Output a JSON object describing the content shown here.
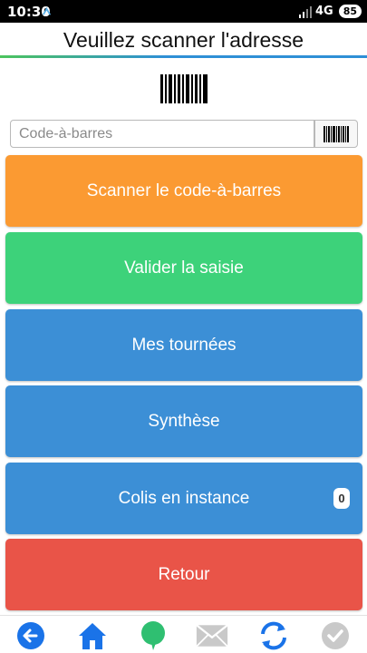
{
  "status_bar": {
    "time": "10:30",
    "network": "4G",
    "battery": "85"
  },
  "header": {
    "title": "Veuillez scanner l'adresse"
  },
  "barcode_field": {
    "placeholder": "Code-à-barres",
    "value": ""
  },
  "buttons": {
    "scan": "Scanner le code-à-barres",
    "validate": "Valider la saisie",
    "tours": "Mes tournées",
    "summary": "Synthèse",
    "pending": "Colis en instance",
    "pending_count": "0",
    "back": "Retour"
  },
  "bottom_nav": [
    "back-arrow-icon",
    "home-icon",
    "chat-bubble-icon",
    "mail-icon",
    "sync-icon",
    "check-icon"
  ],
  "colors": {
    "orange": "#fb9a32",
    "green": "#3dd27a",
    "blue": "#3c8fd6",
    "red": "#e95448",
    "nav_blue": "#1a73e8"
  }
}
